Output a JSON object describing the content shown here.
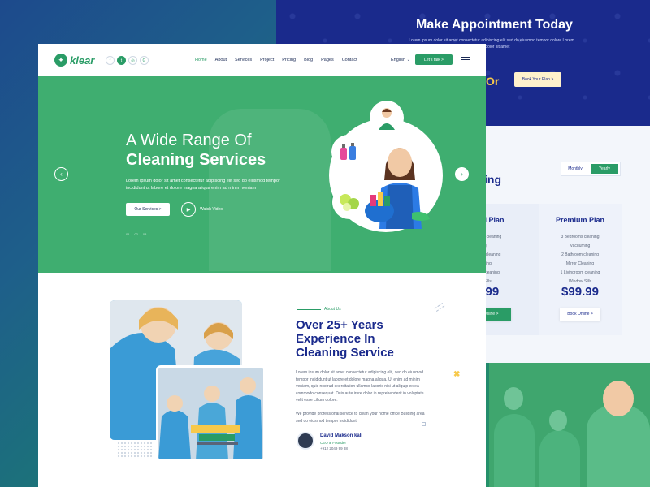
{
  "colors": {
    "green": "#2a9c66",
    "navy": "#1a2a8c",
    "yellow": "#f7c94b"
  },
  "nav": {
    "logo": "klear",
    "menu": [
      "Home",
      "About",
      "Services",
      "Project",
      "Pricing",
      "Blog",
      "Pages",
      "Contact"
    ],
    "language": "English",
    "cta": "Let's talk >"
  },
  "hero": {
    "title_line1": "A Wide Range Of",
    "title_line2": "Cleaning Services",
    "description": "Lorem ipsum dolor sit amet consectetur adipiscing elit sed do eiusmod tempor incididunt ut labore et dolore magna aliqua enim ad minim veniam",
    "button": "Our Services >",
    "watch_label": "Watch Video",
    "slides": [
      "01",
      "02",
      "03"
    ]
  },
  "about": {
    "label": "About Us",
    "title": "Over 25+ Years Experience In Cleaning Service",
    "paragraph1": "Lorem ipsum dolor sit amet consectetur adipiscing elit, sed do eiusmod tempor incididunt ut labore et dolore magna aliqua. Ut enim ad minim veniam, quis nostrud exercitation ullamco laboris nisi ut aliquip ex ea commodo consequat. Duis aute irure dolor in reprehenderit in voluptate velit esse cillum dolore.",
    "paragraph2": "We provide professional service to clean your home office Building area sed do eiusmod tempor incididunt.",
    "author_name": "David Makson kali",
    "author_role": "CEO & Founder",
    "author_phone": "+912 2049 99 88"
  },
  "appointment": {
    "title": "Make Appointment Today",
    "description": "Lorem ipsum dolor sit amet consectetur adipiscing elit sed do eiusmod tempor dolore Lorem ipsum dolor sit amet",
    "or": "Or",
    "button": "Book Your Plan >"
  },
  "pricing": {
    "heading_partial": "ing",
    "toggle": [
      "Monthly",
      "Yearly"
    ],
    "standard": {
      "title": "ard Plan",
      "features": [
        "ooms cleaning",
        "uming",
        "room cleaning",
        "Cleaning",
        "oom cleaning",
        "dow Sills"
      ],
      "price": "9.99",
      "button": "Online >"
    },
    "premium": {
      "title": "Premium Plan",
      "features": [
        "3 Bedrooms cleaning",
        "Vacuuming",
        "2 Bathroom cleaning",
        "Mirror Cleaning",
        "1 Livingroom cleaning",
        "Window Sills"
      ],
      "price": "$99.99",
      "button": "Book Online >"
    }
  }
}
